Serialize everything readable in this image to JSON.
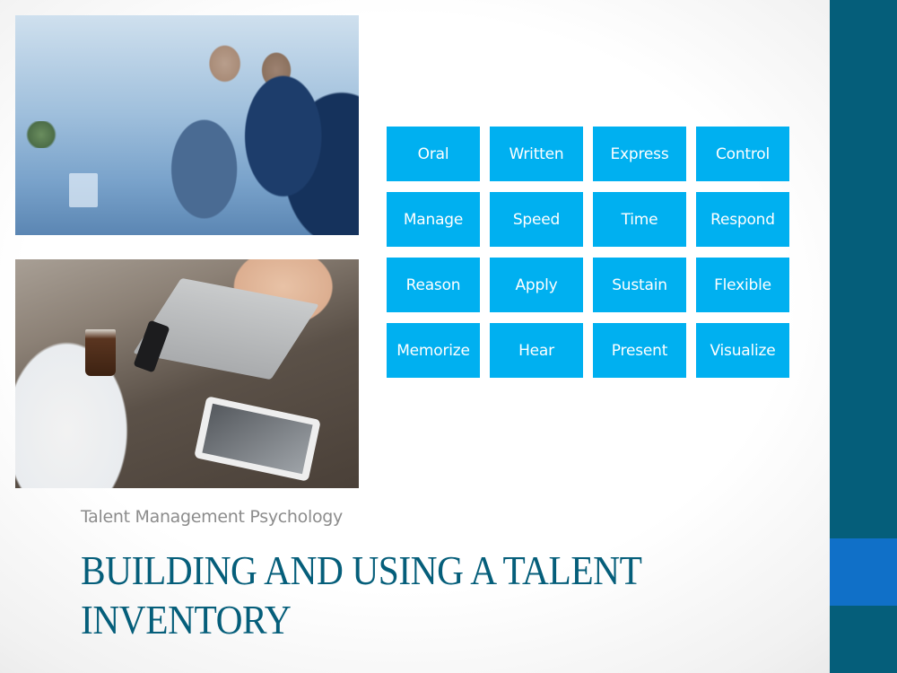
{
  "slide": {
    "subtitle": "Talent Management Psychology",
    "title_line1": "BUILDING AND USING A TALENT",
    "title_line2": "INVENTORY"
  },
  "images": [
    {
      "name": "business-meeting-photo",
      "description": "Two businessmen in suits reviewing a tablet"
    },
    {
      "name": "cafe-devices-photo",
      "description": "People at wooden table with laptop, phone, tablet and iced coffee"
    }
  ],
  "talent_grid": {
    "rows": [
      [
        "Oral",
        "Written",
        "Express",
        "Control"
      ],
      [
        "Manage",
        "Speed",
        "Time",
        "Respond"
      ],
      [
        "Reason",
        "Apply",
        "Sustain",
        "Flexible"
      ],
      [
        "Memorize",
        "Hear",
        "Present",
        "Visualize"
      ]
    ]
  },
  "colors": {
    "tile": "#00b0f0",
    "title": "#055e7a",
    "sidebar": "#055e7a",
    "sidebar_accent": "#1070c8",
    "subtitle": "#8c8c8c"
  }
}
